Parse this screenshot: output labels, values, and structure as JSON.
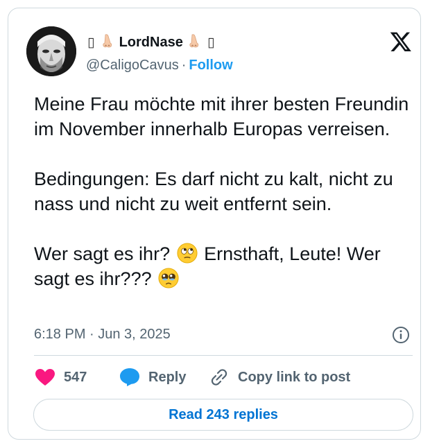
{
  "author": {
    "name_prefix_glyph": "▯",
    "name": "LordNase",
    "name_suffix_glyph": "▯",
    "handle": "@CaligoCavus",
    "separator": "·",
    "follow_label": "Follow"
  },
  "tweet": {
    "paragraph1": "Meine Frau möchte mit ihrer besten Freundin im November innerhalb Europas verreisen.",
    "paragraph2": "Bedingungen: Es darf nicht zu kalt, nicht zu nass und nicht zu weit entfernt sein.",
    "paragraph3_part1": "Wer sagt es ihr?",
    "paragraph3_part2": "Ernsthaft, Leute! Wer sagt es ihr???",
    "emoji1": "eye-roll-emoji",
    "emoji2": "pleading-face-emoji"
  },
  "meta": {
    "timestamp": "6:18 PM · Jun 3, 2025"
  },
  "actions": {
    "like_count": "547",
    "reply_label": "Reply",
    "copy_link_label": "Copy link to post"
  },
  "read_replies_label": "Read 243 replies",
  "colors": {
    "accent": "#1d9bf0",
    "like": "#f91880",
    "read_replies": "#0074d3",
    "secondary_text": "#536471",
    "border": "#cfd9de"
  }
}
